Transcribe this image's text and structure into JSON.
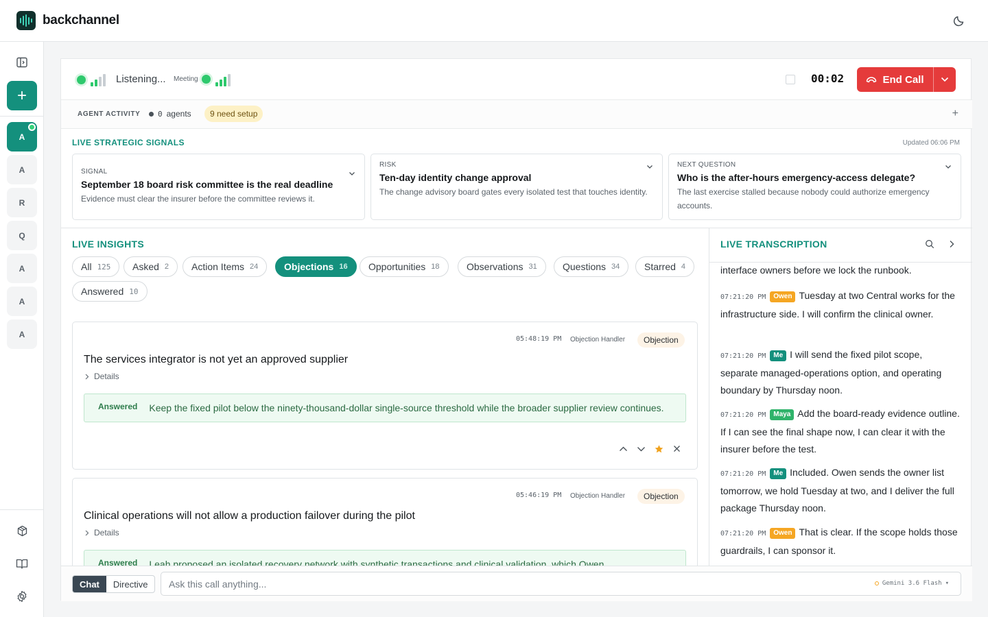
{
  "app": {
    "name": "backchannel"
  },
  "sidebar": {
    "conversations": [
      "A",
      "A",
      "R",
      "Q",
      "A",
      "A",
      "A"
    ]
  },
  "call": {
    "status": "Listening...",
    "meeting_label": "Meeting",
    "timer": "00:02",
    "end_call_label": "End Call"
  },
  "agents": {
    "label": "AGENT ACTIVITY",
    "count": "0",
    "count_suffix": "agents",
    "setup": "9 need setup"
  },
  "signals": {
    "heading": "LIVE STRATEGIC SIGNALS",
    "updated": "Updated 06:06 PM",
    "cards": [
      {
        "kicker": "SIGNAL",
        "title": "September 18 board risk committee is the real deadline",
        "desc": "Evidence must clear the insurer before the committee reviews it."
      },
      {
        "kicker": "RISK",
        "title": "Ten-day identity change approval",
        "desc": "The change advisory board gates every isolated test that touches identity."
      },
      {
        "kicker": "NEXT QUESTION",
        "title": "Who is the after-hours emergency-access delegate?",
        "desc": "The last exercise stalled because nobody could authorize emergency accounts."
      }
    ]
  },
  "insights": {
    "heading": "LIVE INSIGHTS",
    "filters": [
      {
        "label": "All",
        "count": "125"
      },
      {
        "label": "Asked",
        "count": "2"
      },
      {
        "label": "Action Items",
        "count": "24"
      },
      {
        "label": "Objections",
        "count": "16"
      },
      {
        "label": "Opportunities",
        "count": "18"
      },
      {
        "label": "Observations",
        "count": "31"
      },
      {
        "label": "Questions",
        "count": "34"
      },
      {
        "label": "Starred",
        "count": "4"
      },
      {
        "label": "Answered",
        "count": "10"
      }
    ],
    "active_filter": "Objections",
    "cards": [
      {
        "time": "05:48:19 PM",
        "handler": "Objection Handler",
        "tag": "Objection",
        "title": "The services integrator is not yet an approved supplier",
        "details": "Details",
        "answer_label": "Answered",
        "answer": "Keep the fixed pilot below the ninety-thousand-dollar single-source threshold while the broader supplier review continues.",
        "starred": true
      },
      {
        "time": "05:46:19 PM",
        "handler": "Objection Handler",
        "tag": "Objection",
        "title": "Clinical operations will not allow a production failover during the pilot",
        "details": "Details",
        "answer_label": "Answered",
        "answer": "Leah proposed an isolated recovery network with synthetic transactions and clinical validation, which Owen"
      }
    ]
  },
  "transcription": {
    "heading": "LIVE TRANSCRIPTION",
    "top_fragment": "interface owners before we lock the runbook.",
    "lines": [
      {
        "time": "07:21:20 PM",
        "speaker": "Owen",
        "text": "Tuesday at two Central works for the infrastructure side. I will confirm the clinical owner."
      },
      {
        "time": "07:21:20 PM",
        "speaker": "Me",
        "text": "I will send the fixed pilot scope, separate managed-operations option, and operating boundary by Thursday noon."
      },
      {
        "time": "07:21:20 PM",
        "speaker": "Maya",
        "text": "Add the board-ready evidence outline. If I can see the final shape now, I can clear it with the insurer before the test."
      },
      {
        "time": "07:21:20 PM",
        "speaker": "Me",
        "text": "Included. Owen sends the owner list tomorrow, we hold Tuesday at two, and I deliver the full package Thursday noon."
      },
      {
        "time": "07:21:20 PM",
        "speaker": "Owen",
        "text": "That is clear. If the scope holds those guardrails, I can sponsor it."
      }
    ]
  },
  "composer": {
    "modes": [
      "Chat",
      "Directive"
    ],
    "active_mode": "Chat",
    "placeholder": "Ask this call anything...",
    "model": "Gemini 3.6 Flash"
  },
  "colors": {
    "accent": "#14907d",
    "danger": "#e53b3b",
    "live": "#2ec96d",
    "owen": "#f5a623",
    "maya": "#2fb36a"
  }
}
